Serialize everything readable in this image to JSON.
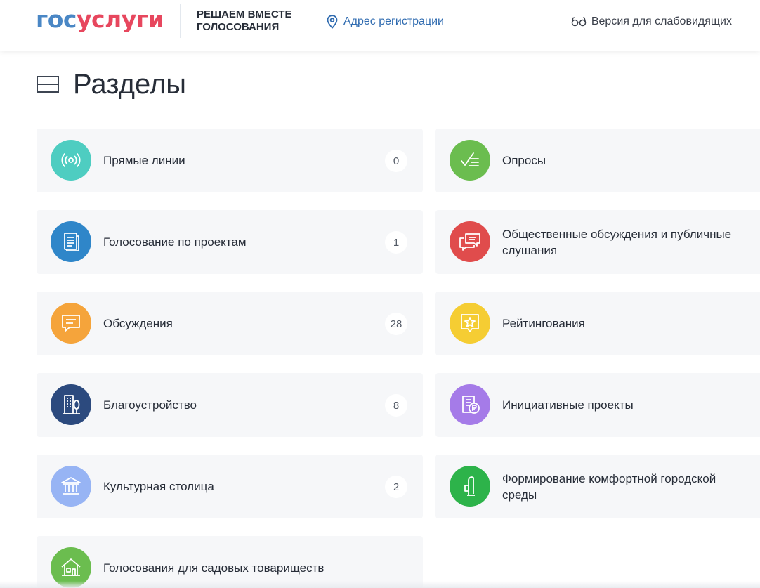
{
  "header": {
    "logo": {
      "part1": "гос",
      "part2": "услуги"
    },
    "project_title": "РЕШАЕМ ВМЕСТЕ\nГОЛОСОВАНИЯ",
    "address_label": "Адрес регистрации",
    "accessibility_label": "Версия для слабовидящих"
  },
  "page": {
    "title": "Разделы"
  },
  "sections": [
    {
      "label": "Прямые линии",
      "count": "0",
      "icon": "broadcast-icon",
      "color": "#4ecdc1"
    },
    {
      "label": "Опросы",
      "count": "",
      "icon": "checklist-icon",
      "color": "#6bbd4f"
    },
    {
      "label": "Голосование по проектам",
      "count": "1",
      "icon": "document-icon",
      "color": "#2f86c9"
    },
    {
      "label": "Общественные обсуждения и публичные слушания",
      "count": "",
      "icon": "chat-bubbles-icon",
      "color": "#e04c4c"
    },
    {
      "label": "Обсуждения",
      "count": "28",
      "icon": "message-icon",
      "color": "#f5a43b"
    },
    {
      "label": "Рейтингования",
      "count": "",
      "icon": "star-frame-icon",
      "color": "#f5cd33"
    },
    {
      "label": "Благоустройство",
      "count": "8",
      "icon": "building-tree-icon",
      "color": "#2c4a7e"
    },
    {
      "label": "Инициативные проекты",
      "count": "",
      "icon": "ruble-document-icon",
      "color": "#a57be8"
    },
    {
      "label": "Культурная столица",
      "count": "2",
      "icon": "museum-icon",
      "color": "#97b4f4"
    },
    {
      "label": "Формирование комфортной городской среды",
      "count": "",
      "icon": "city-lamp-icon",
      "color": "#2db34a"
    },
    {
      "label": "Голосования для садовых товариществ",
      "count": "",
      "icon": "house-icon",
      "color": "#6bbd4f"
    }
  ]
}
